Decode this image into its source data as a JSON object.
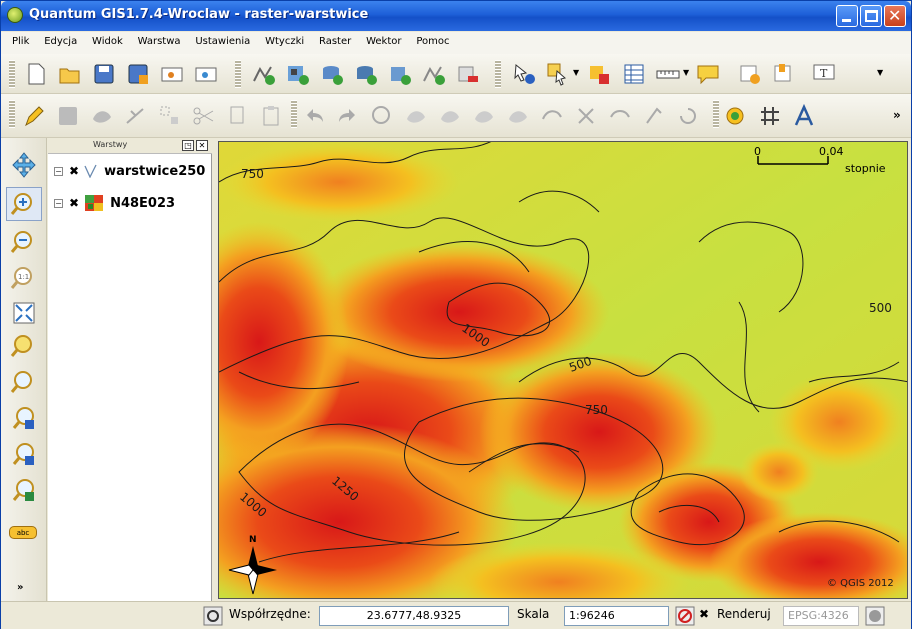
{
  "window": {
    "title": "Quantum GIS1.7.4-Wroclaw - raster-warstwice"
  },
  "menu": [
    "Plik",
    "Edycja",
    "Widok",
    "Warstwa",
    "Ustawienia",
    "Wtyczki",
    "Raster",
    "Wektor",
    "Pomoc"
  ],
  "layers_panel": {
    "title": "Warstwy",
    "layers": [
      {
        "name": "warstwice250",
        "type": "vector",
        "checked": true,
        "expanded": true
      },
      {
        "name": "N48E023",
        "type": "raster",
        "checked": true,
        "expanded": true
      }
    ]
  },
  "map": {
    "scalebar": {
      "start": "0",
      "end": "0.04",
      "unit": "stopnie"
    },
    "contour_labels": [
      "750",
      "1000",
      "500",
      "500",
      "750",
      "1250",
      "1000"
    ],
    "north_label": "N",
    "copyright": "© QGIS 2012",
    "colors": {
      "low": "#c8e040",
      "mid": "#f4c020",
      "high": "#e02020",
      "line": "#1a1a1a"
    }
  },
  "status": {
    "coords_label": "Współrzędne:",
    "coords_value": "23.6777,48.9325",
    "scale_label": "Skala",
    "scale_value": "1:96246",
    "render_label": "Renderuj",
    "epsg": "EPSG:4326"
  }
}
